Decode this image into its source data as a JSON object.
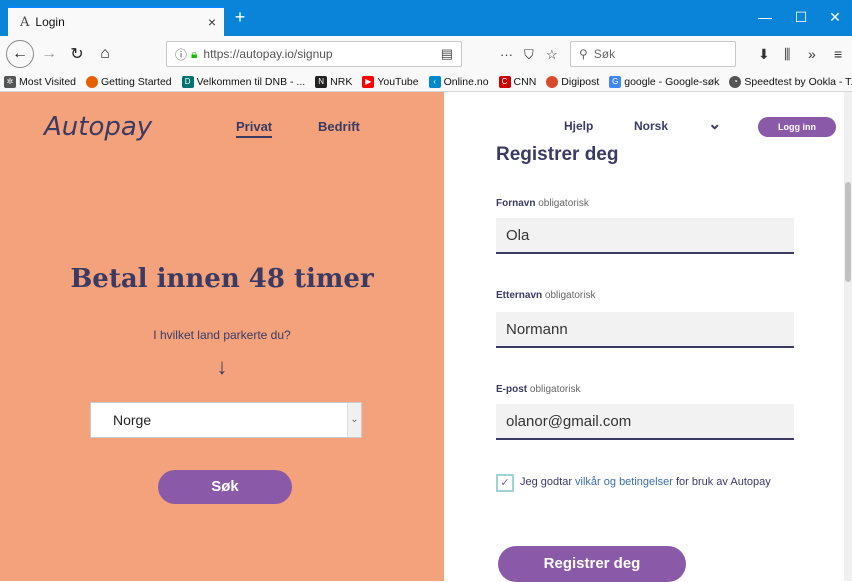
{
  "browser": {
    "tab": {
      "favicon": "A",
      "title": "Login",
      "close": "×"
    },
    "new_tab": "+",
    "window_controls": {
      "minimize": "—",
      "maximize": "☐",
      "close": "✕"
    },
    "url": "https://autopay.io/signup",
    "search_placeholder": "Søk",
    "bookmarks": [
      {
        "label": "Most Visited",
        "icon": "gear-icon",
        "color": "#555555"
      },
      {
        "label": "Getting Started",
        "icon": "firefox-icon",
        "color": "#e66000"
      },
      {
        "label": "Velkommen til DNB - ...",
        "icon": "dnb-icon",
        "color": "#007272"
      },
      {
        "label": "NRK",
        "icon": "nrk-icon",
        "color": "#222222"
      },
      {
        "label": "YouTube",
        "icon": "youtube-icon",
        "color": "#ff0000"
      },
      {
        "label": "Online.no",
        "icon": "online-icon",
        "color": "#0088cc"
      },
      {
        "label": "CNN",
        "icon": "cnn-icon",
        "color": "#cc0000"
      },
      {
        "label": "Digipost",
        "icon": "digipost-icon",
        "color": "#d94a2b"
      },
      {
        "label": "google - Google-søk",
        "icon": "google-icon",
        "color": "#4285f4"
      },
      {
        "label": "Speedtest by Ookla - T...",
        "icon": "speedtest-icon",
        "color": "#555555"
      }
    ]
  },
  "left": {
    "logo": "Autopay",
    "nav": {
      "privat": "Privat",
      "bedrift": "Bedrift"
    },
    "headline": "Betal innen 48 timer",
    "question": "I hvilket land parkerte du?",
    "arrow": "↓",
    "country": "Norge",
    "search_button": "Søk"
  },
  "right": {
    "nav": {
      "help": "Hjelp",
      "language": "Norsk",
      "chevron": "⌄",
      "login": "Logg inn"
    },
    "form_title": "Registrer deg",
    "fields": {
      "firstname": {
        "label": "Fornavn",
        "hint": "obligatorisk",
        "value": "Ola"
      },
      "lastname": {
        "label": "Etternavn",
        "hint": "obligatorisk",
        "value": "Normann"
      },
      "email": {
        "label": "E-post",
        "hint": "obligatorisk",
        "value": "olanor@gmail.com"
      }
    },
    "terms": {
      "before": "Jeg godtar ",
      "link": "vilkår og betingelser",
      "after": " for bruk av Autopay"
    },
    "register_button": "Registrer deg"
  },
  "colors": {
    "accent": "#8a5aa8",
    "left_bg": "#f3a27c",
    "text_dark": "#3a3a63",
    "browser_blue": "#0a84d8"
  }
}
